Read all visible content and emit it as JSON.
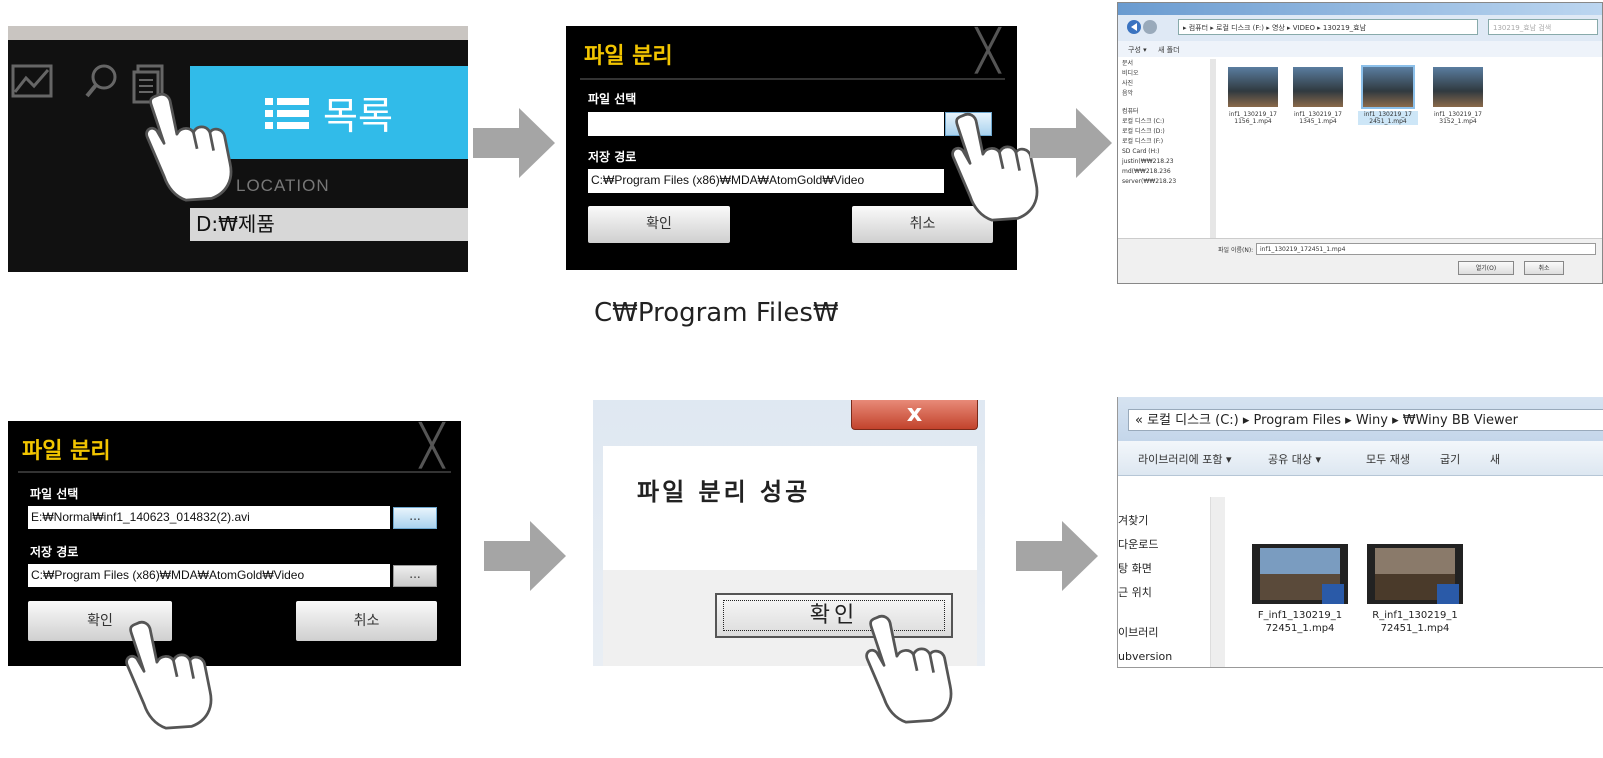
{
  "steps": {
    "step1": {
      "menu_label": "목록",
      "location_label": "LOCATION",
      "location_value": "D:₩제품"
    },
    "step2": {
      "title": "파일 분리",
      "file_select_label": "파일 선택",
      "file_select_value": "",
      "save_path_label": "저장 경로",
      "save_path_value": "C:₩Program Files (x86)₩MDA₩AtomGold₩Video",
      "ok_label": "확인",
      "cancel_label": "취소"
    },
    "caption": "C₩Program Files₩",
    "step3": {
      "address": "▸ 컴퓨터 ▸ 로컬 디스크 (F:) ▸ 영상 ▸ VIDEO ▸ 130219_효남",
      "search_placeholder": "130219_효남 검색",
      "toolbar": [
        "구성 ▾",
        "새 폴더"
      ],
      "nav_items": [
        "문서",
        "비디오",
        "사진",
        "음악",
        "",
        "컴퓨터",
        "로컬 디스크 (C:)",
        "로컬 디스크 (D:)",
        "로컬 디스크 (F:)",
        "SD Card (H:)",
        "justin(₩₩218.23",
        "md(₩₩218.236",
        "server(₩₩218.23"
      ],
      "files": [
        "inf1_130219_17 1156_1.mp4",
        "inf1_130219_17 1345_1.mp4",
        "inf1_130219_17 2451_1.mp4",
        "inf1_130219_17 3152_1.mp4"
      ],
      "filename_label": "파일 이름(N):",
      "filename_value": "inf1_130219_172451_1.mp4",
      "open_label": "열기(O)",
      "cancel_label": "취소"
    },
    "step4": {
      "title": "파일 분리",
      "file_select_label": "파일 선택",
      "file_select_value": "E:₩Normal₩inf1_140623_014832(2).avi",
      "save_path_label": "저장 경로",
      "save_path_value": "C:₩Program Files (x86)₩MDA₩AtomGold₩Video",
      "browse_label": "...",
      "ok_label": "확인",
      "cancel_label": "취소"
    },
    "step5": {
      "close_label": "x",
      "message": "파일 분리 성공",
      "ok_label": "확인"
    },
    "step6": {
      "address": "« 로컬 디스크 (C:) ▸ Program Files ▸ Winy ▸ ₩Winy BB Viewer",
      "toolbar": [
        "라이브러리에 포함 ▾",
        "공유 대상 ▾",
        "모두 재생",
        "굽기",
        "새"
      ],
      "nav_items": [
        "겨찾기",
        "다운로드",
        "탕 화면",
        "근 위치",
        "",
        "이브러리",
        "ubversion"
      ],
      "files": [
        "F_inf1_130219_1 72451_1.mp4",
        "R_inf1_130219_1 72451_1.mp4"
      ]
    }
  },
  "colors": {
    "accent_blue": "#31bbe9",
    "title_yellow": "#f2c500",
    "arrow_gray": "#a5a5a5"
  }
}
